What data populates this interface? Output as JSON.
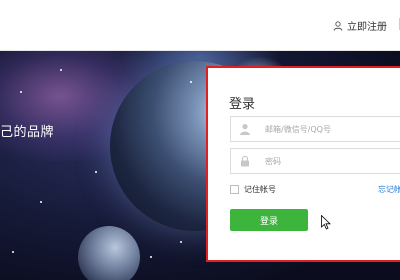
{
  "header": {
    "register_label": "立即注册"
  },
  "banner": {
    "slogan": "己的品牌"
  },
  "login": {
    "title": "登录",
    "account_placeholder": "邮箱/微信号/QQ号",
    "password_placeholder": "密码",
    "remember_label": "记住帐号",
    "forgot_label": "忘记帐",
    "submit_label": "登录"
  },
  "colors": {
    "highlight_border": "#e12121",
    "login_button": "#3db53d",
    "link": "#2c7fd6"
  },
  "icons": {
    "register": "user-icon",
    "account_field": "user-icon",
    "password_field": "lock-icon",
    "pointer": "mouse-cursor-icon"
  }
}
